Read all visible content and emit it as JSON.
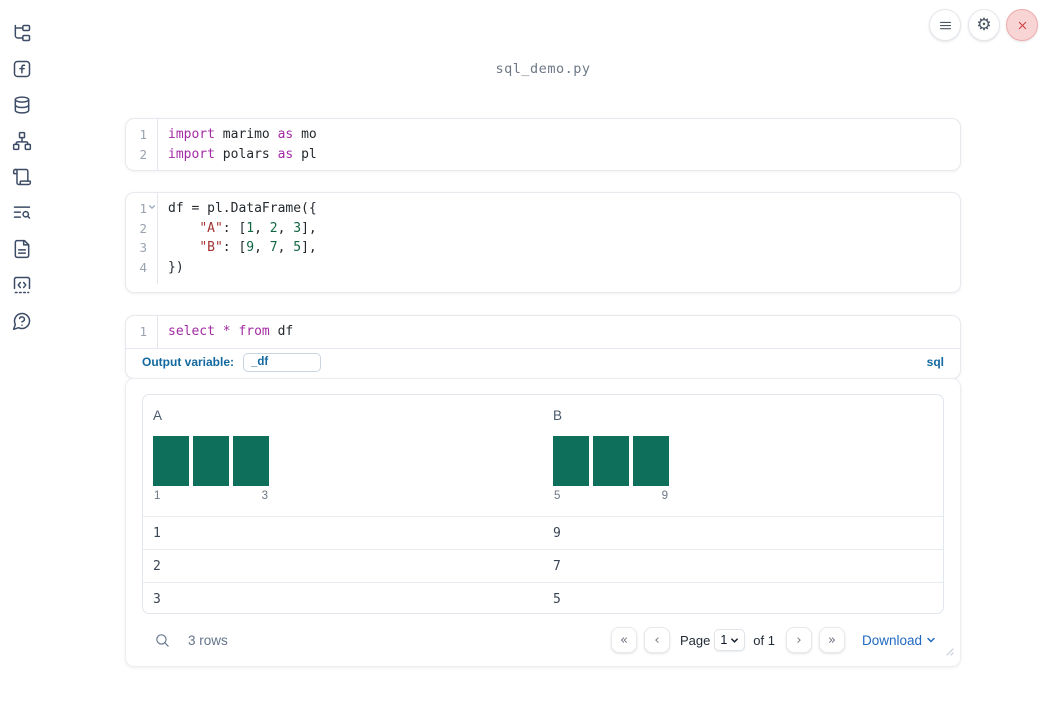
{
  "colors": {
    "keyword": "#a32ba3",
    "string": "#a33333",
    "number": "#116644",
    "bar_teal": "#0e6f5a",
    "label_blue": "#12689f",
    "link_blue": "#2169c1"
  },
  "header": {
    "filename": "sql_demo.py"
  },
  "window_controls": {
    "menu_icon": "hamburger-menu-icon",
    "settings_icon": "gear-icon",
    "close_icon": "close-x-icon"
  },
  "sidebar": {
    "items": [
      {
        "icon": "file-tree-icon"
      },
      {
        "icon": "function-icon"
      },
      {
        "icon": "database-icon"
      },
      {
        "icon": "dependency-graph-icon"
      },
      {
        "icon": "scroll-icon"
      },
      {
        "icon": "list-search-icon"
      },
      {
        "icon": "document-icon"
      },
      {
        "icon": "code-snippet-icon"
      },
      {
        "icon": "help-icon"
      }
    ]
  },
  "cells": [
    {
      "fold_line": null,
      "lines": [
        [
          [
            "kw",
            "import"
          ],
          [
            "pl",
            " marimo "
          ],
          [
            "kw",
            "as"
          ],
          [
            "pl",
            " mo"
          ]
        ],
        [
          [
            "kw",
            "import"
          ],
          [
            "pl",
            " polars "
          ],
          [
            "kw",
            "as"
          ],
          [
            "pl",
            " pl"
          ]
        ]
      ]
    },
    {
      "fold_line": 0,
      "lines": [
        [
          [
            "pl",
            "df = pl.DataFrame({"
          ]
        ],
        [
          [
            "pl",
            "    "
          ],
          [
            "str",
            "\"A\""
          ],
          [
            "pl",
            ": ["
          ],
          [
            "num",
            "1"
          ],
          [
            "pl",
            ", "
          ],
          [
            "num",
            "2"
          ],
          [
            "pl",
            ", "
          ],
          [
            "num",
            "3"
          ],
          [
            "pl",
            "],"
          ]
        ],
        [
          [
            "pl",
            "    "
          ],
          [
            "str",
            "\"B\""
          ],
          [
            "pl",
            ": ["
          ],
          [
            "num",
            "9"
          ],
          [
            "pl",
            ", "
          ],
          [
            "num",
            "7"
          ],
          [
            "pl",
            ", "
          ],
          [
            "num",
            "5"
          ],
          [
            "pl",
            "],"
          ]
        ],
        [
          [
            "pl",
            "})"
          ]
        ]
      ]
    },
    {
      "fold_line": null,
      "lines": [
        [
          [
            "kw",
            "select"
          ],
          [
            "pl",
            " "
          ],
          [
            "kw",
            "*"
          ],
          [
            "pl",
            " "
          ],
          [
            "kw",
            "from"
          ],
          [
            "pl",
            " df"
          ]
        ]
      ],
      "output_variable_label": "Output variable:",
      "output_variable_value": "_df",
      "language_badge": "sql"
    }
  ],
  "table": {
    "columns": [
      {
        "name": "A",
        "histogram": {
          "values": [
            1,
            1,
            1
          ],
          "axis_labels": [
            "1",
            "3"
          ]
        }
      },
      {
        "name": "B",
        "histogram": {
          "values": [
            1,
            1,
            1
          ],
          "axis_labels": [
            "5",
            "9"
          ]
        }
      }
    ],
    "rows": [
      [
        "1",
        "9"
      ],
      [
        "2",
        "7"
      ],
      [
        "3",
        "5"
      ]
    ],
    "footer": {
      "row_count": "3 rows",
      "pagination": {
        "first": "«",
        "prev": "‹",
        "page_label": "Page",
        "page_value": "1",
        "of_label": "of 1",
        "next": "›",
        "last": "»"
      },
      "download_label": "Download"
    }
  }
}
